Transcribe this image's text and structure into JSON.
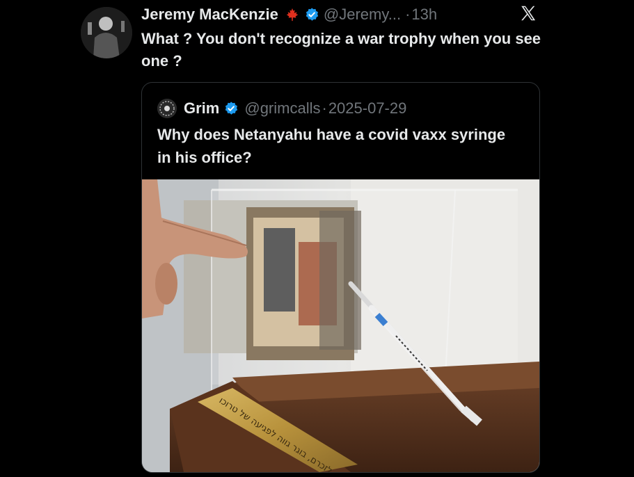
{
  "tweet": {
    "author_name": "Jeremy MacKenzie",
    "handle": "@Jeremy...",
    "separator": "·",
    "time": "13h",
    "text": "What ? You don't recognize a war trophy when you see one ?"
  },
  "quoted": {
    "author_name": "Grim",
    "handle": "@grimcalls",
    "separator": "·",
    "date": "2025-07-29",
    "text": "Why does Netanyahu have a covid vaxx syringe in his office?",
    "plaque_text": "לזכרם, בוגר גווה לפגיעה של טרוכו"
  },
  "icons": {
    "brand": "x-logo-icon",
    "flag": "maple-leaf-icon",
    "verified": "verified-badge-icon"
  },
  "colors": {
    "background": "#000000",
    "text": "#e7e9ea",
    "secondary": "#71767b",
    "verified": "#1d9bf0",
    "leaf": "#e0301e",
    "border": "#2f3336"
  }
}
